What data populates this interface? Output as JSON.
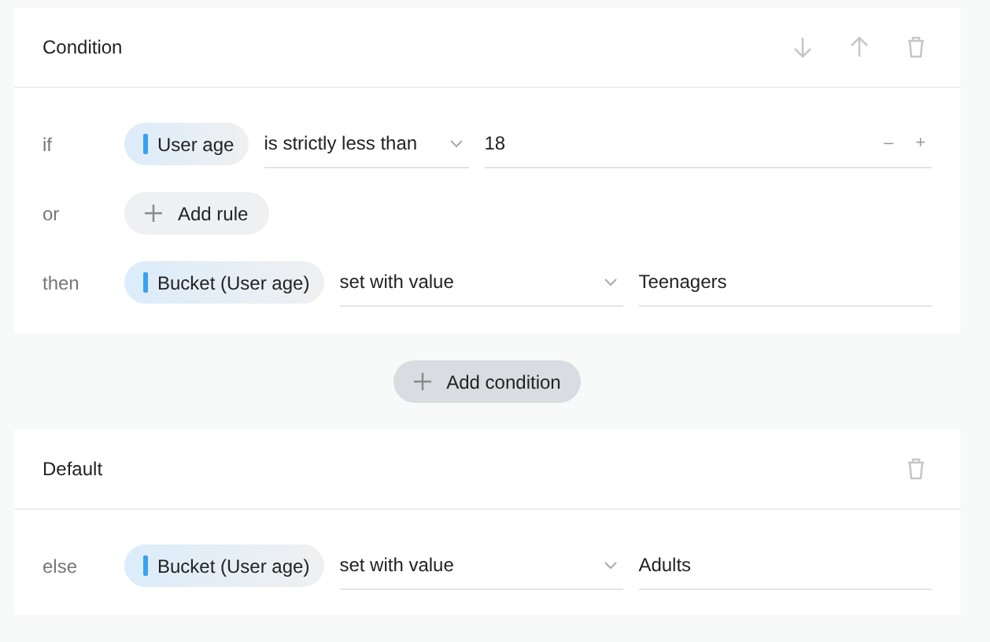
{
  "condition": {
    "title": "Condition",
    "if": {
      "keyword": "if",
      "field": "User age",
      "operator": "is strictly less than",
      "value": "18",
      "minus": "–",
      "plus": "+"
    },
    "or": {
      "keyword": "or",
      "button": "Add rule"
    },
    "then": {
      "keyword": "then",
      "field": "Bucket (User age)",
      "operator": "set with value",
      "value": "Teenagers"
    }
  },
  "add_condition": "Add condition",
  "default": {
    "title": "Default",
    "else": {
      "keyword": "else",
      "field": "Bucket (User age)",
      "operator": "set with value",
      "value": "Adults"
    }
  }
}
